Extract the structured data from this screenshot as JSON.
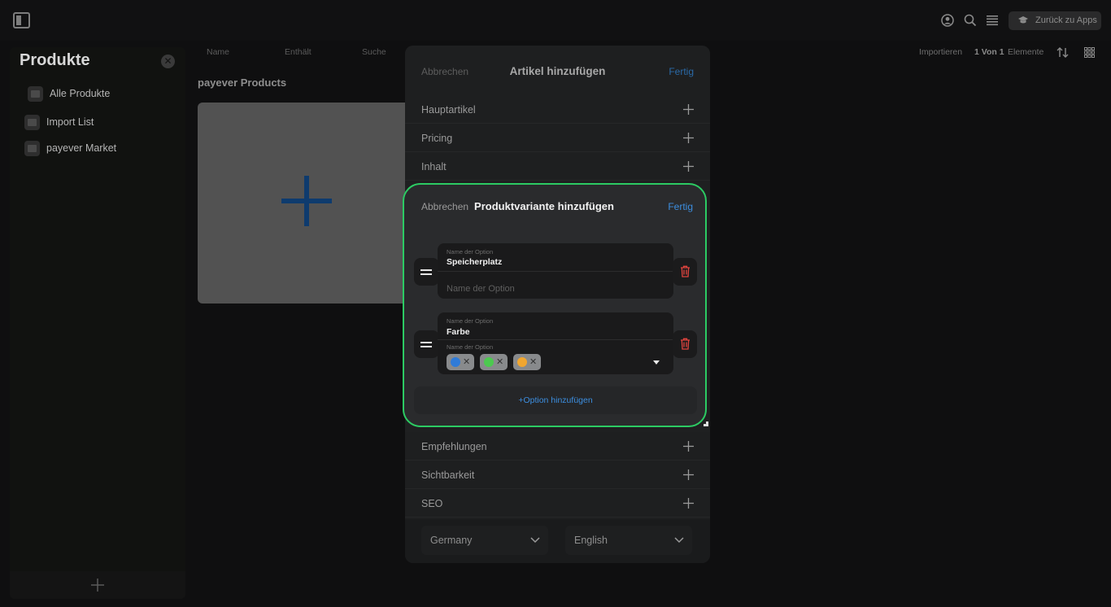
{
  "topbar": {
    "back_label": "Zurück zu Apps"
  },
  "sidebar": {
    "title": "Produkte",
    "items": [
      {
        "label": "Alle Produkte"
      },
      {
        "label": "Import List"
      },
      {
        "label": "payever Market"
      }
    ]
  },
  "toolbar": {
    "col_name": "Name",
    "col_contains": "Enthält",
    "search": "Suche",
    "import": "Importieren",
    "page": "1 Von 1",
    "elements": "Elemente"
  },
  "main": {
    "section_title": "payever Products"
  },
  "modal": {
    "cancel": "Abbrechen",
    "title": "Artikel hinzufügen",
    "done": "Fertig",
    "rows_top": [
      "Hauptartikel",
      "Pricing",
      "Inhalt"
    ],
    "rows_bottom": [
      "Empfehlungen",
      "Sichtbarkeit",
      "SEO"
    ],
    "country": "Germany",
    "language": "English"
  },
  "variant": {
    "cancel": "Abbrechen",
    "title": "Produktvariante hinzufügen",
    "done": "Fertig",
    "options": [
      {
        "caption": "Name der Option",
        "value": "Speicherplatz",
        "values_placeholder": "Name der Option"
      },
      {
        "caption": "Name der Option",
        "value": "Farbe",
        "values_caption": "Name der Option",
        "chips": [
          {
            "color": "#2f7bd8"
          },
          {
            "color": "#4cc94f"
          },
          {
            "color": "#f0a630"
          }
        ]
      }
    ],
    "add_option": "+Option hinzufügen"
  }
}
